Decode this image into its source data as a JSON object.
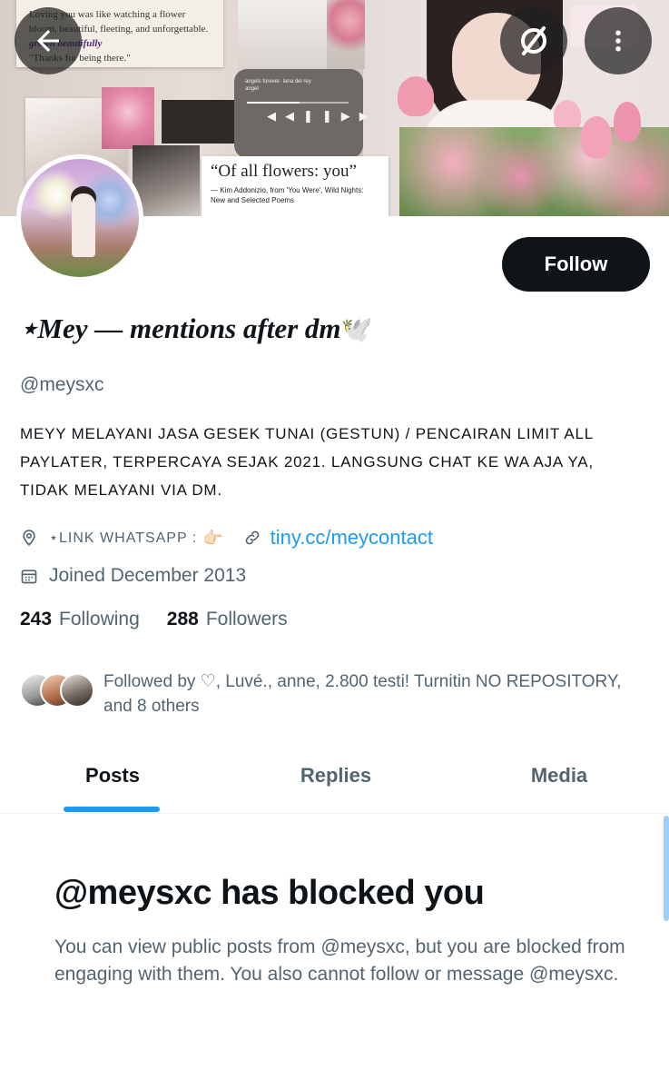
{
  "banner": {
    "note_text": "Loving you was like watching a flower bloom, beautiful, fleeting, and unforgettable.",
    "note_line2": "grown beautifully",
    "note_line3": "\"Thanks for being there.\"",
    "player_song": "angels forever- lana del rey",
    "player_artist": "angel",
    "quote_title": "“Of all flowers: you”",
    "quote_source": "— Kim Addonizio, from 'You Were', Wild Nights: New and Selected Poems"
  },
  "header": {
    "back_icon": "arrow-left-icon",
    "grok_icon": "grok-icon",
    "more_icon": "more-vertical-icon"
  },
  "profile": {
    "display_name": "⋆Mey — mentions after dm",
    "display_name_emoji": "🕊️",
    "handle": "@meysxc",
    "bio": "MEYY MELAYANI JASA GESEK TUNAI (GESTUN) / PENCAIRAN LIMIT ALL PAYLATER, TERPERCAYA SEJAK 2021. LANGSUNG CHAT KE WA AJA YA, TIDAK MELAYANI VIA DM.",
    "location": "⋆LINK WHATSAPP :",
    "location_emoji": "👉🏻",
    "website": "tiny.cc/meycontact",
    "joined": "Joined December 2013",
    "follow_label": "Follow",
    "following_count": "243",
    "following_label": "Following",
    "followers_count": "288",
    "followers_label": "Followers",
    "followed_by_text": "Followed by ♡, Luvé., anne, 2.800 testi! Turnitin NO REPOSITORY, and 8 others"
  },
  "tabs": [
    {
      "label": "Posts",
      "active": true
    },
    {
      "label": "Replies",
      "active": false
    },
    {
      "label": "Media",
      "active": false
    }
  ],
  "blocked": {
    "title": "@meysxc has blocked you",
    "message": "You can view public posts from @meysxc, but you are blocked from engaging with them. You also cannot follow or message @meysxc."
  },
  "colors": {
    "accent": "#1d9bf0",
    "text_primary": "#0f1419",
    "text_secondary": "#536471",
    "follow_button": "#0f1419"
  }
}
